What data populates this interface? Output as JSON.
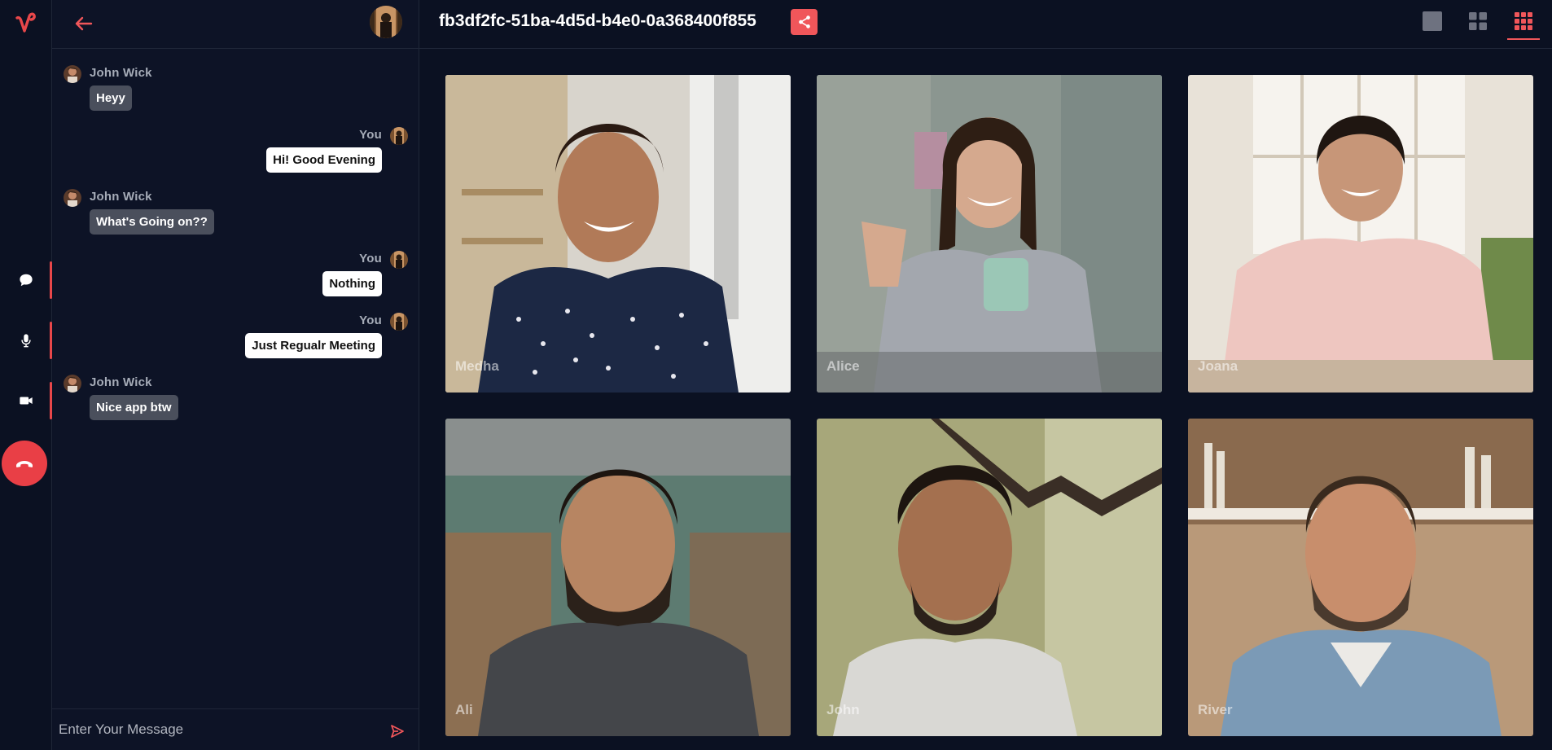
{
  "app": {
    "brand_color": "#e8474a",
    "logo_icon": "v-logo-icon"
  },
  "rail": {
    "items": [
      {
        "icon": "chat-icon",
        "active": true
      },
      {
        "icon": "microphone-icon",
        "active": true
      },
      {
        "icon": "video-camera-icon",
        "active": true
      }
    ],
    "end_call_icon": "end-call-icon",
    "end_call_color": "#e93f46"
  },
  "chat": {
    "back_icon": "arrow-left-icon",
    "messages": [
      {
        "sender": "John Wick",
        "text": "Heyy",
        "side": "left"
      },
      {
        "sender": "You",
        "text": "Hi! Good Evening",
        "side": "right"
      },
      {
        "sender": "John Wick",
        "text": "What's Going on??",
        "side": "left"
      },
      {
        "sender": "You",
        "text": "Nothing",
        "side": "right"
      },
      {
        "sender": "You",
        "text": "Just Regualr Meeting",
        "side": "right"
      },
      {
        "sender": "John Wick",
        "text": "Nice app btw",
        "side": "left"
      }
    ],
    "composer": {
      "placeholder": "Enter Your Message",
      "value": "",
      "send_icon": "send-icon"
    }
  },
  "topbar": {
    "room_id": "fb3df2fc-51ba-4d5d-b4e0-0a368400f855",
    "share_icon": "share-icon",
    "layouts": [
      {
        "icon": "single-view-icon",
        "active": false
      },
      {
        "icon": "grid-2x2-icon",
        "active": false
      },
      {
        "icon": "grid-3x3-icon",
        "active": true
      }
    ]
  },
  "participants": [
    {
      "name": "Medha"
    },
    {
      "name": "Alice"
    },
    {
      "name": "Joana"
    },
    {
      "name": "Ali"
    },
    {
      "name": "John"
    },
    {
      "name": "River"
    }
  ]
}
